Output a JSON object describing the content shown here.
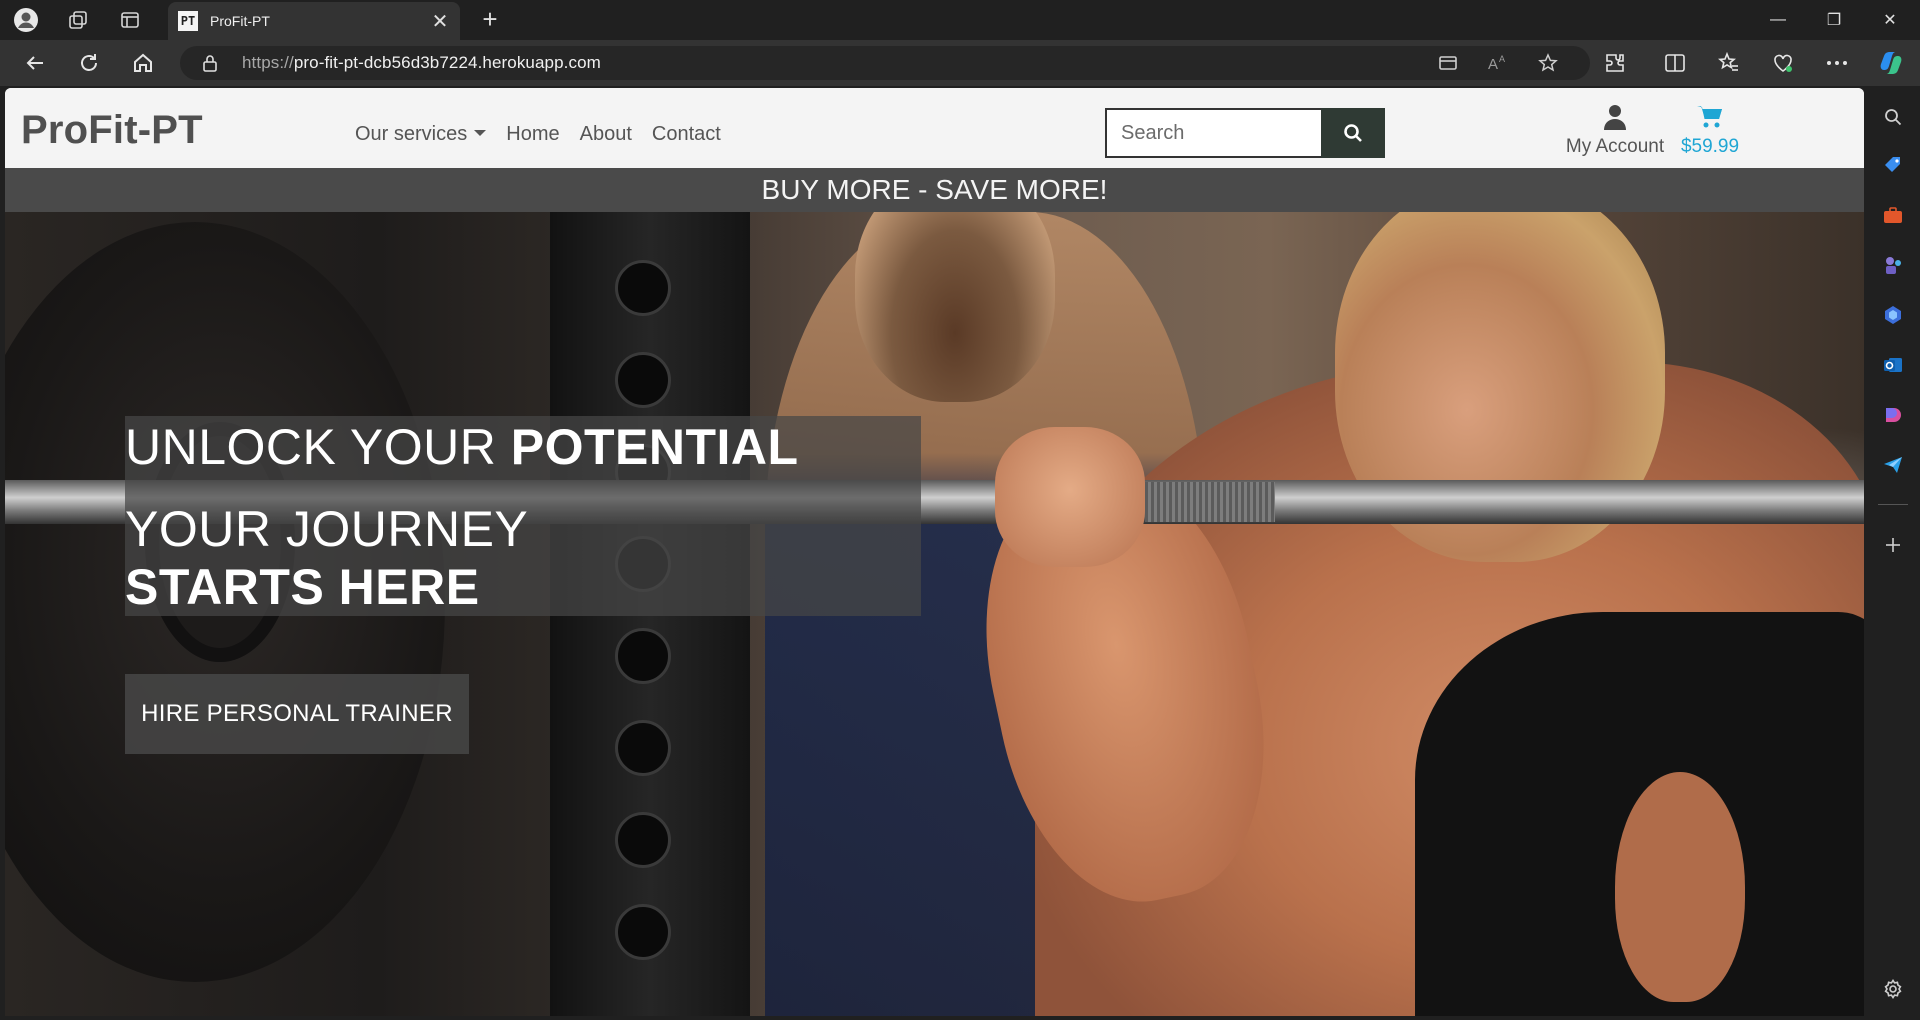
{
  "browser": {
    "tab": {
      "favicon_text": "PT",
      "title": "ProFit-PT",
      "close": "✕"
    },
    "new_tab": "+",
    "url_scheme": "https://",
    "url_host": "pro-fit-pt-dcb56d3b7224.herokuapp.com",
    "window_controls": {
      "minimize": "—",
      "restore": "❐",
      "close": "✕"
    }
  },
  "site": {
    "brand": "ProFit-PT",
    "nav": {
      "services": "Our services",
      "home": "Home",
      "about": "About",
      "contact": "Contact"
    },
    "search": {
      "placeholder": "Search"
    },
    "account_label": "My Account",
    "cart_total": "$59.99",
    "promo_banner": "BUY MORE - SAVE MORE!",
    "hero": {
      "line1_light": "UNLOCK YOUR ",
      "line1_bold": "POTENTIAL",
      "line2": "YOUR JOURNEY",
      "line3": "STARTS HERE",
      "cta": "HIRE PERSONAL TRAINER"
    }
  },
  "colors": {
    "cart_accent": "#1fa6d4",
    "banner_bg": "#4a4a4a",
    "search_button_bg": "#2f3a34"
  }
}
